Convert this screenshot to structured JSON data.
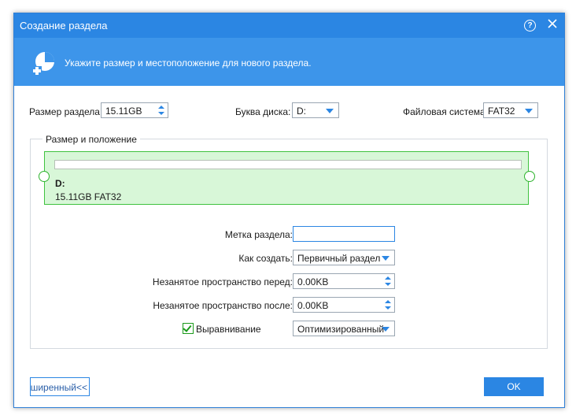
{
  "window": {
    "title": "Создание раздела",
    "help_symbol": "?"
  },
  "header": {
    "text": "Укажите размер и местоположение для нового раздела."
  },
  "top_fields": {
    "size_label": "Размер раздела:",
    "size_value": "15.11GB",
    "drive_letter_label": "Буква диска:",
    "drive_letter_value": "D:",
    "fs_label": "Файловая система:",
    "fs_value": "FAT32"
  },
  "layout_group": {
    "title": "Размер и положение",
    "partition_letter": "D:",
    "partition_info": "15.11GB FAT32"
  },
  "form": {
    "label_label": "Метка раздела:",
    "label_value": "",
    "create_as_label": "Как создать:",
    "create_as_value": "Первичный раздел",
    "free_before_label": "Незанятое пространство перед:",
    "free_before_value": "0.00KB",
    "free_after_label": "Незанятое пространство после:",
    "free_after_value": "0.00KB",
    "alignment_label": "Выравнивание",
    "alignment_checked": true,
    "alignment_value": "Оптимизированный"
  },
  "buttons": {
    "advanced_label": "асширенный<<",
    "ok_label": "OK"
  },
  "colors": {
    "accent": "#2b86e3",
    "header": "#3d95ea",
    "partition_fill": "#d8f7d8",
    "partition_border": "#3fc23f"
  }
}
